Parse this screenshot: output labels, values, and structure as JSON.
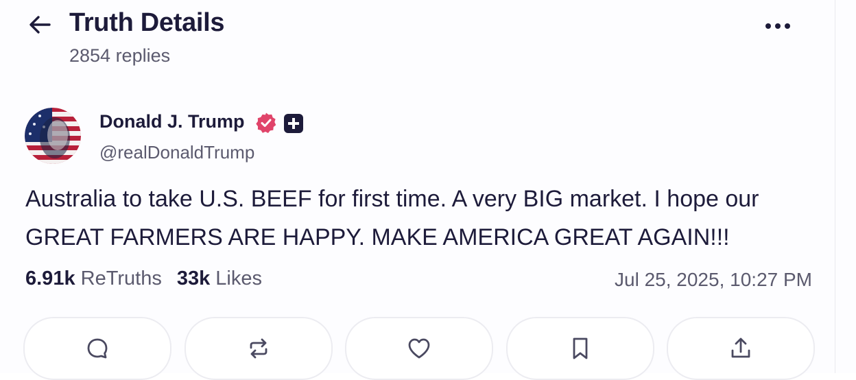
{
  "header": {
    "title": "Truth Details",
    "replies": "2854 replies",
    "back_icon": "arrow-left-icon",
    "more_icon": "more-horizontal-icon"
  },
  "post": {
    "author": {
      "name": "Donald J. Trump",
      "handle": "@realDonaldTrump",
      "verified_icon": "verified-check-icon",
      "badge_icon": "plus-badge-icon"
    },
    "text": "Australia to take U.S. BEEF for first time. A very BIG market. I hope our GREAT FARMERS ARE HAPPY. MAKE AMERICA GREAT AGAIN!!!",
    "stats": {
      "retruths_count": "6.91k",
      "retruths_label": "ReTruths",
      "likes_count": "33k",
      "likes_label": "Likes"
    },
    "timestamp": "Jul 25, 2025, 10:27 PM"
  },
  "actions": [
    {
      "name": "reply",
      "icon": "reply-bubble-icon"
    },
    {
      "name": "retruth",
      "icon": "retruth-arrows-icon"
    },
    {
      "name": "like",
      "icon": "heart-icon"
    },
    {
      "name": "bookmark",
      "icon": "bookmark-icon"
    },
    {
      "name": "share",
      "icon": "share-upload-icon"
    }
  ],
  "colors": {
    "text_primary": "#1d1b3a",
    "text_secondary": "#5b5a6e",
    "verified": "#e0446a",
    "border": "#ececf1"
  }
}
